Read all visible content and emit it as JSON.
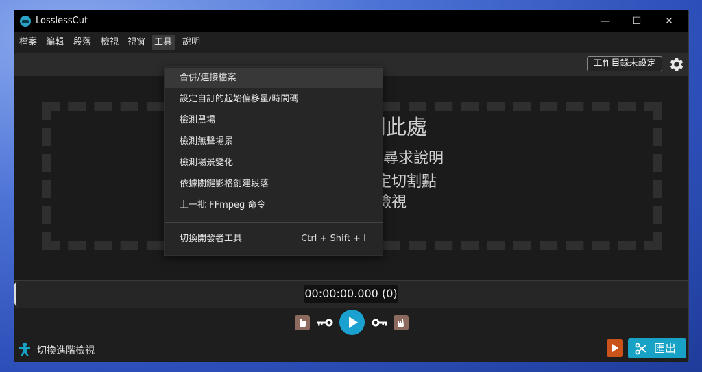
{
  "window": {
    "title": "LosslessCut",
    "min": "—",
    "max": "☐",
    "close": "✕"
  },
  "menu": [
    {
      "label": "檔案"
    },
    {
      "label": "編輯"
    },
    {
      "label": "段落"
    },
    {
      "label": "檢視"
    },
    {
      "label": "視窗"
    },
    {
      "label": "工具"
    },
    {
      "label": "說明"
    }
  ],
  "toolbar": {
    "workdir_label": "工作目錄未設定"
  },
  "tools_menu": {
    "items": [
      {
        "label": "合併/連接檔案"
      },
      {
        "label": "設定自訂的起始偏移量/時間碼"
      },
      {
        "label": "檢測黑場"
      },
      {
        "label": "檢測無聲場景"
      },
      {
        "label": "檢測場景變化"
      },
      {
        "label": "依據關鍵影格創建段落"
      },
      {
        "label": "上一批 FFmpeg 命令"
      }
    ],
    "dev_item": {
      "label": "切換開發者工具",
      "shortcut": "Ctrl + Shift + I"
    }
  },
  "dropzone": {
    "title": "到此處",
    "line1": "表尋求說明",
    "line2": "設定切割點",
    "line3": "階檢視"
  },
  "timeline": {
    "timecode": "00:00:00.000 (0)"
  },
  "bottom": {
    "advanced_label": "切換進階檢視",
    "export_label": "匯出"
  },
  "colors": {
    "accent": "#17a2c6",
    "export_arrow": "#c9531b",
    "hand_btn": "#8c6a5e"
  }
}
